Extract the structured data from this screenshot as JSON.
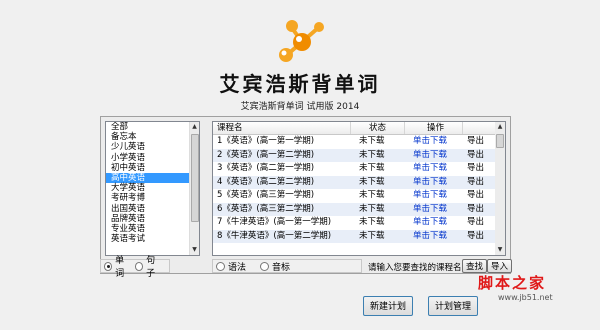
{
  "app": {
    "title": "艾宾浩斯背单词",
    "subtitle": "艾宾浩斯背单词 试用版 2014"
  },
  "categories": {
    "items": [
      "全部",
      "备忘本",
      "少儿英语",
      "小学英语",
      "初中英语",
      "高中英语",
      "大学英语",
      "考研考博",
      "出国英语",
      "品牌英语",
      "专业英语",
      "英语考试"
    ],
    "selected_index": 5
  },
  "mode_radio": {
    "options": [
      {
        "label": "单词",
        "checked": true
      },
      {
        "label": "句子",
        "checked": false
      }
    ]
  },
  "extra_radio": {
    "options": [
      {
        "label": "语法",
        "checked": false
      },
      {
        "label": "音标",
        "checked": false
      }
    ]
  },
  "course_table": {
    "headers": [
      "课程名",
      "状态",
      "操作",
      ""
    ],
    "rows": [
      {
        "name": "1《英语》(高一第一学期)",
        "status": "未下载",
        "action": "单击下载",
        "export": "导出"
      },
      {
        "name": "2《英语》(高一第二学期)",
        "status": "未下载",
        "action": "单击下载",
        "export": "导出"
      },
      {
        "name": "3《英语》(高二第一学期)",
        "status": "未下载",
        "action": "单击下载",
        "export": "导出"
      },
      {
        "name": "4《英语》(高二第二学期)",
        "status": "未下载",
        "action": "单击下载",
        "export": "导出"
      },
      {
        "name": "5《英语》(高三第一学期)",
        "status": "未下载",
        "action": "单击下载",
        "export": "导出"
      },
      {
        "name": "6《英语》(高三第二学期)",
        "status": "未下载",
        "action": "单击下载",
        "export": "导出"
      },
      {
        "name": "7《牛津英语》(高一第一学期)",
        "status": "未下载",
        "action": "单击下载",
        "export": "导出"
      },
      {
        "name": "8《牛津英语》(高一第二学期)",
        "status": "未下载",
        "action": "单击下载",
        "export": "导出"
      }
    ]
  },
  "search": {
    "label": "请输入您要查找的课程名",
    "search_button": "查找",
    "import_button": "导入"
  },
  "actions": {
    "new_plan": "新建计划",
    "plan_manage": "计划管理"
  },
  "watermark": {
    "logo_text": "脚本之家",
    "url": "www.jb51.net"
  },
  "colors": {
    "selection": "#3399ff",
    "link": "#0033cc",
    "logo_orange": "#f5a623",
    "watermark_red": "#e01818"
  }
}
